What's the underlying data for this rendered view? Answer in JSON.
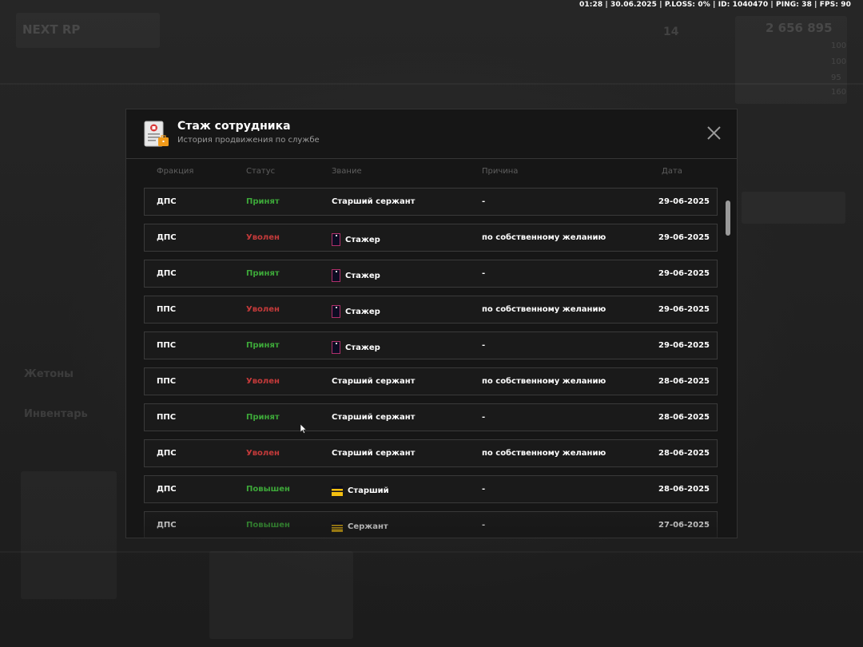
{
  "hud": {
    "status_line": "01:28 | 30.06.2025 | P.LOSS: 0% | ID: 1040470 | PING: 38 | FPS: 90"
  },
  "background": {
    "logo": "NEXT RP",
    "money": "2 656 895",
    "level": "14",
    "tokens_label": "Жетоны",
    "inventory_label": "Инвентарь",
    "stats": [
      "100",
      "100",
      "95",
      "160"
    ]
  },
  "modal": {
    "title": "Стаж сотрудника",
    "subtitle": "История продвижения по службе",
    "icon": "document-badge-icon",
    "close_icon": "close-icon",
    "columns": {
      "faction": "Фракция",
      "status": "Статус",
      "rank": "Звание",
      "reason": "Причина",
      "date": "Дата"
    },
    "rows": [
      {
        "faction": "ДПС",
        "status": "Принят",
        "status_type": "green",
        "rank": "Старший сержант",
        "rank_icon": "none",
        "reason": "-",
        "date": "29-06-2025"
      },
      {
        "faction": "ДПС",
        "status": "Уволен",
        "status_type": "red",
        "rank": "Стажер",
        "rank_icon": "intern-badge-icon",
        "reason": "по собственному желанию",
        "date": "29-06-2025"
      },
      {
        "faction": "ДПС",
        "status": "Принят",
        "status_type": "green",
        "rank": "Стажер",
        "rank_icon": "intern-badge-icon",
        "reason": "-",
        "date": "29-06-2025"
      },
      {
        "faction": "ППС",
        "status": "Уволен",
        "status_type": "red",
        "rank": "Стажер",
        "rank_icon": "intern-badge-icon",
        "reason": "по собственному желанию",
        "date": "29-06-2025"
      },
      {
        "faction": "ППС",
        "status": "Принят",
        "status_type": "green",
        "rank": "Стажер",
        "rank_icon": "intern-badge-icon",
        "reason": "-",
        "date": "29-06-2025"
      },
      {
        "faction": "ППС",
        "status": "Уволен",
        "status_type": "red",
        "rank": "Старший сержант",
        "rank_icon": "none",
        "reason": "по собственному желанию",
        "date": "28-06-2025"
      },
      {
        "faction": "ППС",
        "status": "Принят",
        "status_type": "green",
        "rank": "Старший сержант",
        "rank_icon": "none",
        "reason": "-",
        "date": "28-06-2025"
      },
      {
        "faction": "ДПС",
        "status": "Уволен",
        "status_type": "red",
        "rank": "Старший сержант",
        "rank_icon": "none",
        "reason": "по собственному желанию",
        "date": "28-06-2025"
      },
      {
        "faction": "ДПС",
        "status": "Повышен",
        "status_type": "green",
        "rank": "Старший",
        "rank_icon": "senior-stripes-icon",
        "reason": "-",
        "date": "28-06-2025"
      },
      {
        "faction": "ДПС",
        "status": "Повышен",
        "status_type": "green",
        "rank": "Сержант",
        "rank_icon": "sergeant-stripes-icon",
        "reason": "-",
        "date": "27-06-2025"
      }
    ]
  },
  "colors": {
    "accepted": "#3da839",
    "fired": "#c43a3a",
    "promoted": "#3da839",
    "rank_stripes": "#f5c010",
    "intern_badge_border": "#b0306a"
  }
}
